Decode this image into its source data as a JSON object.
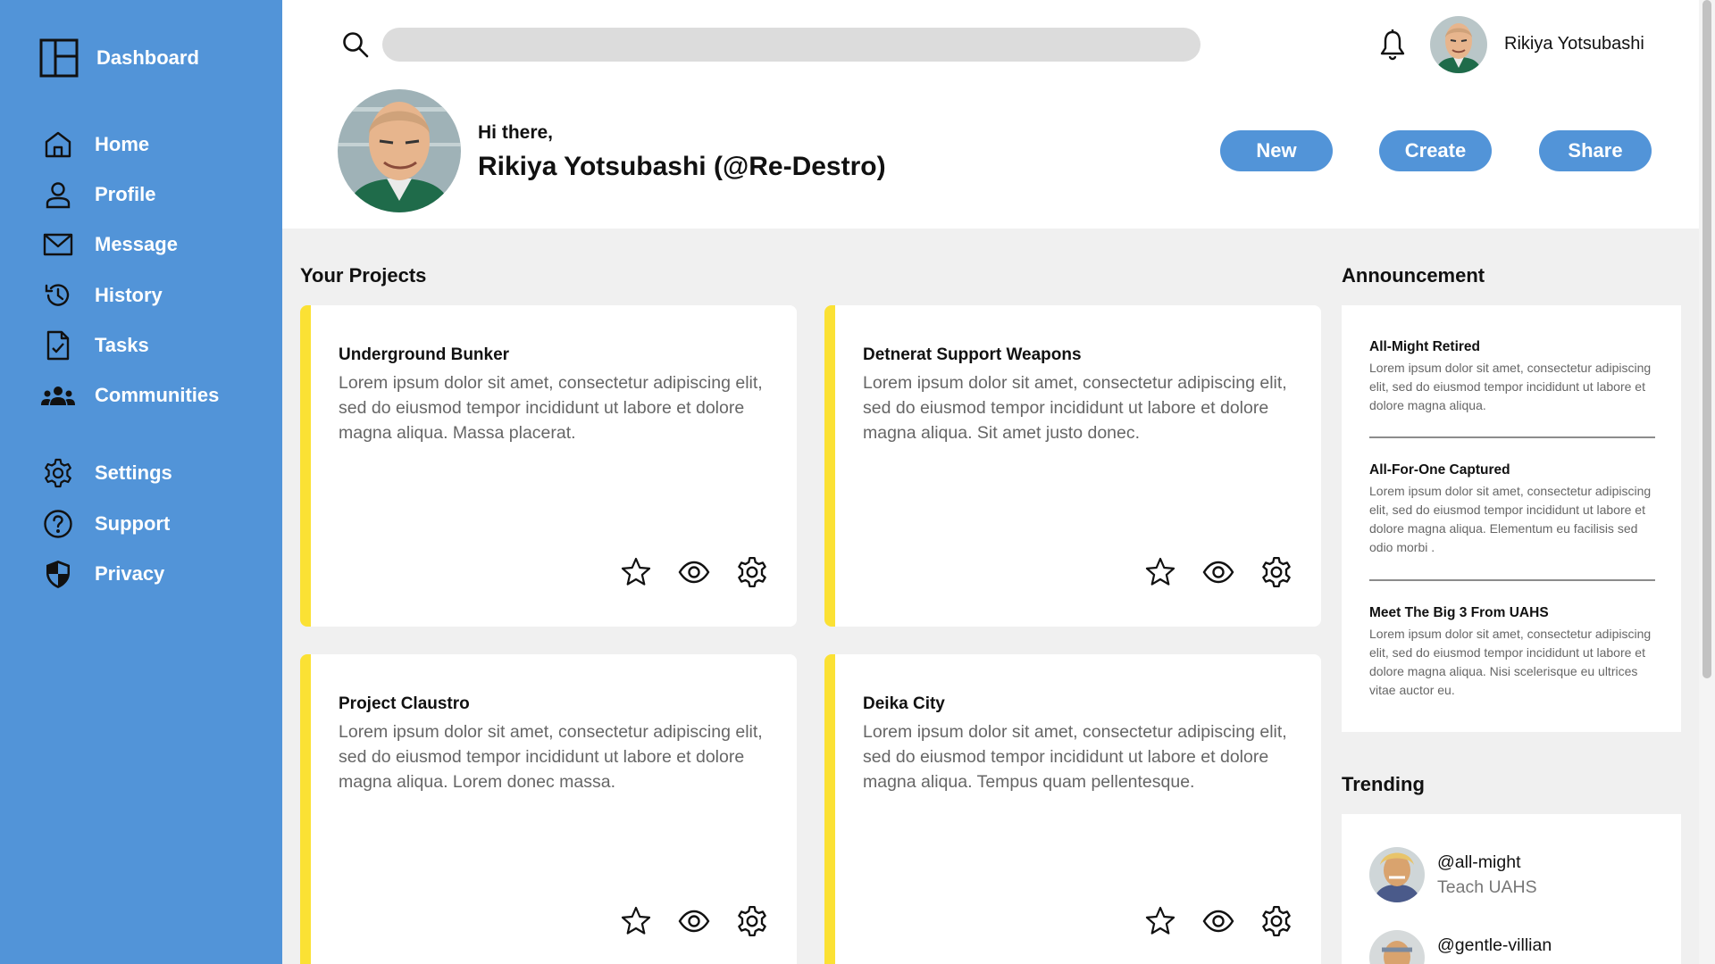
{
  "sidebar": {
    "brand": "Dashboard",
    "items": [
      {
        "label": "Home",
        "icon": "home-icon"
      },
      {
        "label": "Profile",
        "icon": "person-icon"
      },
      {
        "label": "Message",
        "icon": "envelope-icon"
      },
      {
        "label": "History",
        "icon": "history-icon"
      },
      {
        "label": "Tasks",
        "icon": "task-icon"
      },
      {
        "label": "Communities",
        "icon": "group-icon"
      },
      {
        "label": "Settings",
        "icon": "gear-icon"
      },
      {
        "label": "Support",
        "icon": "question-icon"
      },
      {
        "label": "Privacy",
        "icon": "shield-icon"
      }
    ]
  },
  "header": {
    "search": {
      "value": "",
      "placeholder": ""
    },
    "username": "Rikiya Yotsubashi",
    "greeting": "Hi there,",
    "fullname": "Rikiya Yotsubashi (@Re-Destro)",
    "buttons": {
      "new": "New",
      "create": "Create",
      "share": "Share"
    }
  },
  "projects": {
    "title": "Your Projects",
    "items": [
      {
        "title": "Underground Bunker",
        "desc": "Lorem ipsum dolor sit amet, consectetur adipiscing elit, sed do eiusmod tempor incididunt ut labore et dolore magna aliqua. Massa placerat."
      },
      {
        "title": "Detnerat Support Weapons",
        "desc": "Lorem ipsum dolor sit amet, consectetur adipiscing elit, sed do eiusmod tempor incididunt ut labore et dolore magna aliqua. Sit amet justo donec."
      },
      {
        "title": "Project Claustro",
        "desc": "Lorem ipsum dolor sit amet, consectetur adipiscing elit, sed do eiusmod tempor incididunt ut labore et dolore magna aliqua. Lorem donec massa."
      },
      {
        "title": "Deika City",
        "desc": "Lorem ipsum dolor sit amet, consectetur adipiscing elit, sed do eiusmod tempor incididunt ut labore et dolore magna aliqua. Tempus quam pellentesque."
      }
    ]
  },
  "announcements": {
    "title": "Announcement",
    "items": [
      {
        "title": "All-Might Retired",
        "body": "Lorem ipsum dolor sit amet, consectetur adipiscing elit, sed do eiusmod tempor incididunt ut labore et dolore magna aliqua."
      },
      {
        "title": "All-For-One Captured",
        "body": "Lorem ipsum dolor sit amet, consectetur adipiscing elit, sed do eiusmod tempor incididunt ut labore et dolore magna aliqua. Elementum eu facilisis sed odio morbi ."
      },
      {
        "title": "Meet The Big 3 From UAHS",
        "body": "Lorem ipsum dolor sit amet, consectetur adipiscing elit, sed do eiusmod tempor incididunt ut labore et dolore magna aliqua. Nisi scelerisque eu ultrices vitae auctor eu."
      }
    ]
  },
  "trending": {
    "title": "Trending",
    "items": [
      {
        "handle": "@all-might",
        "sub": "Teach UAHS"
      },
      {
        "handle": "@gentle-villian",
        "sub": ""
      }
    ]
  },
  "colors": {
    "accent": "#5294d8",
    "card_stripe": "#fbe134",
    "background": "#f0f0f0"
  }
}
